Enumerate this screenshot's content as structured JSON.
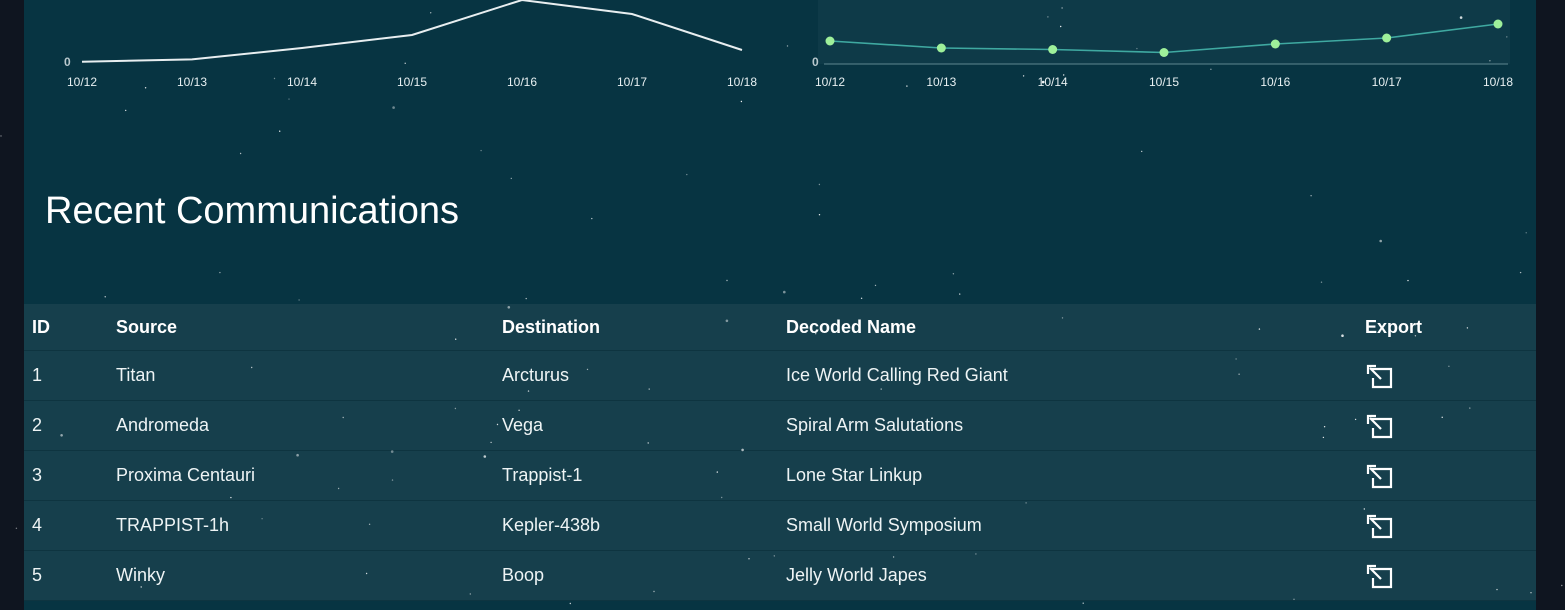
{
  "charts": [
    {
      "id": "left",
      "chart_data": {
        "type": "line",
        "x": [
          "10/12",
          "10/13",
          "10/14",
          "10/15",
          "10/16",
          "10/17",
          "10/18"
        ],
        "series": [
          {
            "values": [
              0.3,
              2.6,
              14,
              27,
              62,
              48,
              12
            ]
          }
        ],
        "y_ticks": [
          "0"
        ],
        "line_color": "#e8eef0",
        "marker": false
      }
    },
    {
      "id": "right",
      "chart_data": {
        "type": "line",
        "x": [
          "10/12",
          "10/13",
          "10/14",
          "10/15",
          "10/16",
          "10/17",
          "10/18"
        ],
        "series": [
          {
            "values": [
              21,
              14,
              12.5,
              9.5,
              18,
              24,
              38
            ]
          }
        ],
        "y_ticks": [
          "0"
        ],
        "line_color": "#3fa9a1",
        "marker_color": "#9ef09a",
        "area_color": "#0e3a48",
        "marker": true
      }
    }
  ],
  "section": {
    "title": "Recent Communications"
  },
  "table": {
    "headers": {
      "id": "ID",
      "source": "Source",
      "destination": "Destination",
      "name": "Decoded Name",
      "export": "Export"
    },
    "rows": [
      {
        "id": "1",
        "source": "Titan",
        "destination": "Arcturus",
        "name": "Ice World Calling Red Giant",
        "export_icon": "export-icon"
      },
      {
        "id": "2",
        "source": "Andromeda",
        "destination": "Vega",
        "name": "Spiral Arm Salutations",
        "export_icon": "export-icon"
      },
      {
        "id": "3",
        "source": "Proxima Centauri",
        "destination": "Trappist-1",
        "name": "Lone Star Linkup",
        "export_icon": "export-icon"
      },
      {
        "id": "4",
        "source": "TRAPPIST-1h",
        "destination": "Kepler-438b",
        "name": "Small World Symposium",
        "export_icon": "export-icon"
      },
      {
        "id": "5",
        "source": "Winky",
        "destination": "Boop",
        "name": "Jelly World Japes",
        "export_icon": "export-icon"
      }
    ]
  },
  "colors": {
    "background": "#0f1520",
    "panel": "#073442",
    "table": "#163f4c",
    "text": "#eef4f5"
  }
}
